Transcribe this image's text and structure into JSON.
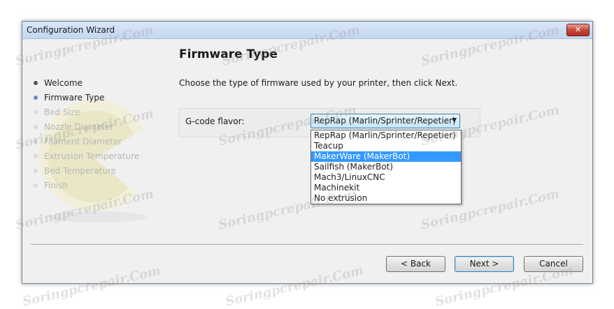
{
  "window": {
    "title": "Configuration Wizard",
    "close_glyph": "✕"
  },
  "steps": [
    {
      "label": "Welcome",
      "state": "done"
    },
    {
      "label": "Firmware Type",
      "state": "current"
    },
    {
      "label": "Bed Size",
      "state": "future"
    },
    {
      "label": "Nozzle Diameter",
      "state": "future"
    },
    {
      "label": "Filament Diameter",
      "state": "future"
    },
    {
      "label": "Extrusion Temperature",
      "state": "future"
    },
    {
      "label": "Bed Temperature",
      "state": "future"
    },
    {
      "label": "Finish",
      "state": "future"
    }
  ],
  "page": {
    "title": "Firmware Type",
    "instructions": "Choose the type of firmware used by your printer, then click Next."
  },
  "gcode": {
    "label": "G-code flavor:",
    "selected": "RepRap (Marlin/Sprinter/Repetier)",
    "arrow_glyph": "▼",
    "options": [
      "RepRap (Marlin/Sprinter/Repetier)",
      "Teacup",
      "MakerWare (MakerBot)",
      "Sailfish (MakerBot)",
      "Mach3/LinuxCNC",
      "Machinekit",
      "No extrusion"
    ],
    "highlighted_index": 2
  },
  "buttons": {
    "back": "< Back",
    "next": "Next >",
    "cancel": "Cancel"
  },
  "watermark": {
    "text": "Soringpcrepair.Com"
  },
  "colors": {
    "highlight": "#3399ff",
    "current_step_bullet": "#5a8fd0",
    "close_button": "#c6473a"
  }
}
